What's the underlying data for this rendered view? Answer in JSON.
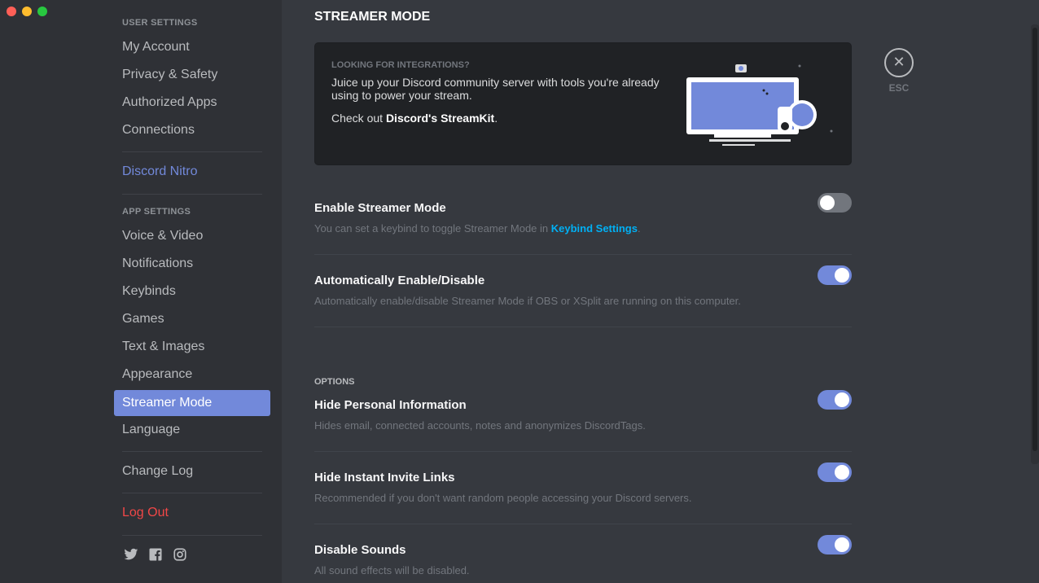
{
  "window": {
    "controls": [
      "close",
      "minimize",
      "maximize"
    ]
  },
  "sidebar": {
    "user_settings_header": "User Settings",
    "user_items": [
      {
        "label": "My Account"
      },
      {
        "label": "Privacy & Safety"
      },
      {
        "label": "Authorized Apps"
      },
      {
        "label": "Connections"
      }
    ],
    "nitro_label": "Discord Nitro",
    "app_settings_header": "App Settings",
    "app_items": [
      {
        "label": "Voice & Video"
      },
      {
        "label": "Notifications"
      },
      {
        "label": "Keybinds"
      },
      {
        "label": "Games"
      },
      {
        "label": "Text & Images"
      },
      {
        "label": "Appearance"
      },
      {
        "label": "Streamer Mode",
        "selected": true
      },
      {
        "label": "Language"
      }
    ],
    "change_log_label": "Change Log",
    "logout_label": "Log Out",
    "social_icons": [
      "twitter-icon",
      "facebook-icon",
      "instagram-icon"
    ]
  },
  "main": {
    "page_title": "Streamer Mode",
    "banner": {
      "label": "Looking for integrations?",
      "text": "Juice up your Discord community server with tools you're already using to power your stream.",
      "link_prefix": "Check out ",
      "link_text": "Discord's StreamKit",
      "link_suffix": "."
    },
    "settings": [
      {
        "title": "Enable Streamer Mode",
        "desc_prefix": "You can set a keybind to toggle Streamer Mode in ",
        "desc_link": "Keybind Settings",
        "desc_suffix": ".",
        "enabled": false
      },
      {
        "title": "Automatically Enable/Disable",
        "desc": "Automatically enable/disable Streamer Mode if OBS or XSplit are running on this computer.",
        "enabled": true
      }
    ],
    "options_header": "Options",
    "options": [
      {
        "title": "Hide Personal Information",
        "desc": "Hides email, connected accounts, notes and anonymizes DiscordTags.",
        "enabled": true
      },
      {
        "title": "Hide Instant Invite Links",
        "desc": "Recommended if you don't want random people accessing your Discord servers.",
        "enabled": true
      },
      {
        "title": "Disable Sounds",
        "desc": "All sound effects will be disabled.",
        "enabled": true
      }
    ]
  },
  "close": {
    "icon": "close-icon",
    "label": "ESC"
  },
  "colors": {
    "accent": "#7289da",
    "link": "#00b0f4",
    "danger": "#f04747",
    "background": "#36393f",
    "sidebar": "#2f3136"
  }
}
